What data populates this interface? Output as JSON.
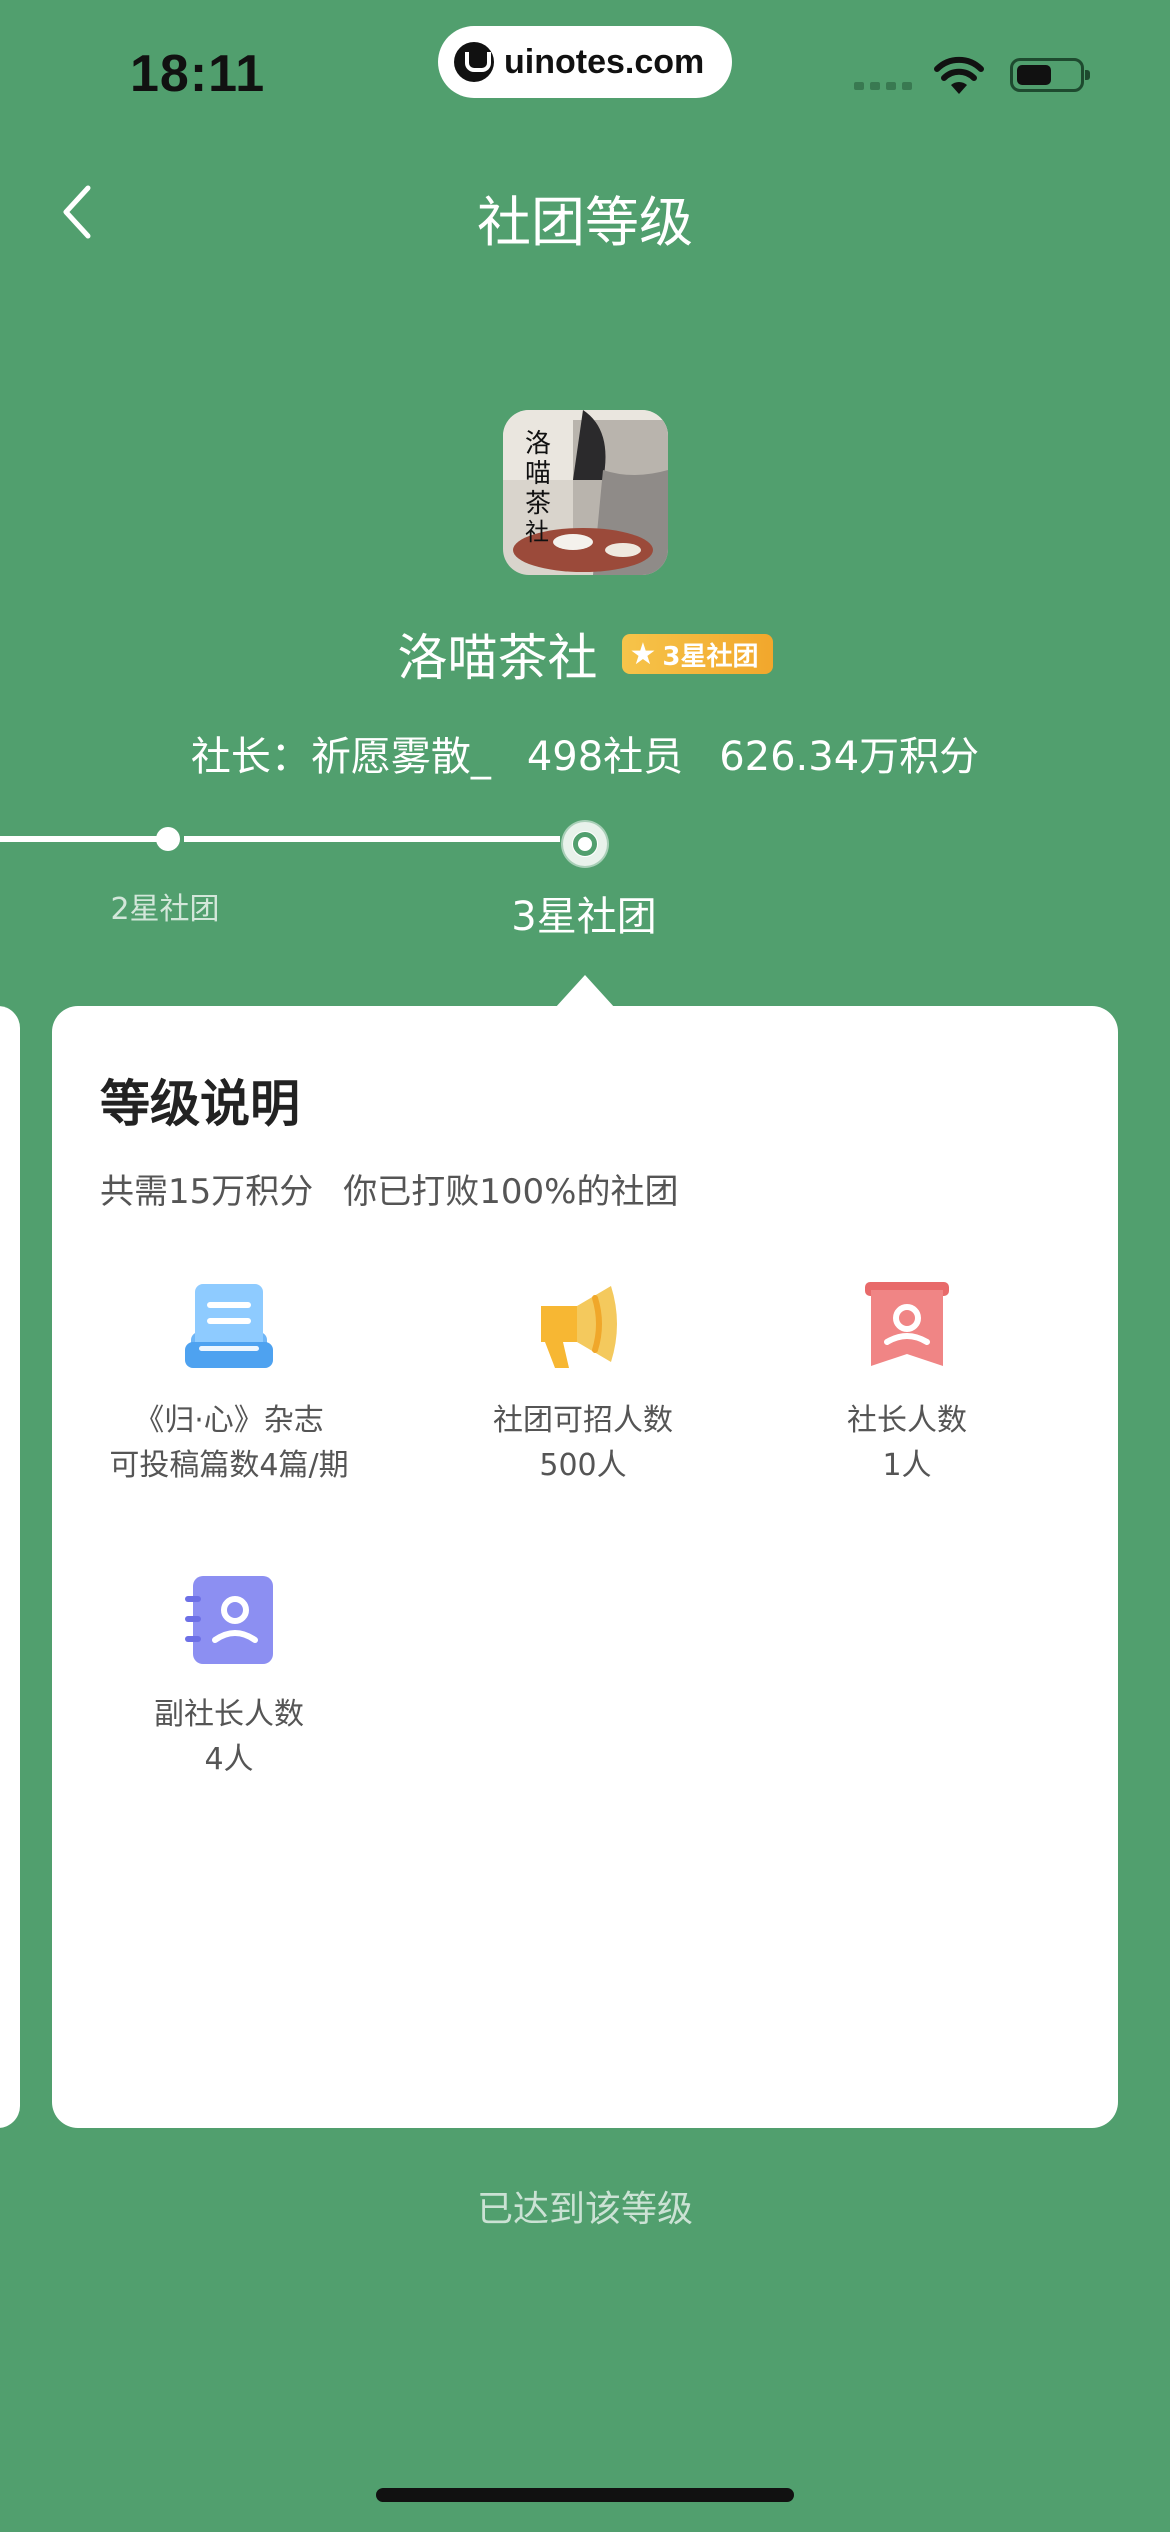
{
  "status_bar": {
    "time": "18:11",
    "watermark": "uinotes.com"
  },
  "nav": {
    "title": "社团等级",
    "back_icon": "chevron-left-icon"
  },
  "club": {
    "name": "洛喵茶社",
    "badge": "3星社团",
    "badge_icon": "star-icon",
    "stats": {
      "leader": "社长：祈愿雾散_",
      "members": "498社员",
      "points": "626.34万积分"
    }
  },
  "timeline": {
    "prev_level": "2星社团",
    "current_level": "3星社团"
  },
  "card": {
    "title": "等级说明",
    "points_needed": "共需15万积分",
    "beat_text": "你已打败100%的社团",
    "perks": [
      {
        "icon": "document-stack-icon",
        "line1": "《归·心》杂志",
        "line2": "可投稿篇数4篇/期"
      },
      {
        "icon": "megaphone-icon",
        "line1": "社团可招人数",
        "line2": "500人"
      },
      {
        "icon": "leader-badge-icon",
        "line1": "社长人数",
        "line2": "1人"
      },
      {
        "icon": "contact-book-icon",
        "line1": "副社长人数",
        "line2": "4人"
      }
    ]
  },
  "footer": {
    "status": "已达到该等级"
  },
  "colors": {
    "background": "#519f6e",
    "badge": "#f2a72c",
    "card": "#ffffff"
  }
}
